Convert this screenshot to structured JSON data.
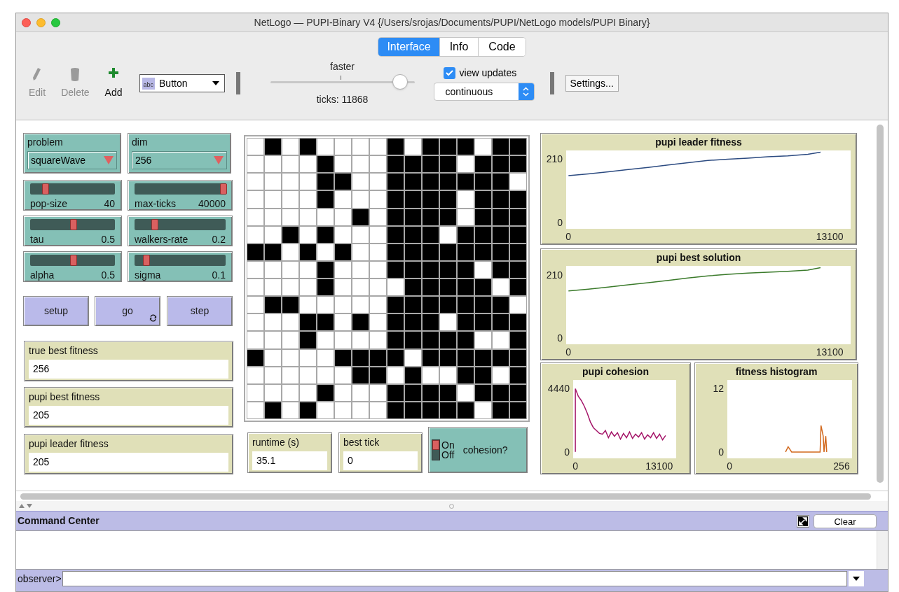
{
  "window": {
    "title": "NetLogo — PUPI-Binary V4 {/Users/srojas/Documents/PUPI/NetLogo models/PUPI Binary}"
  },
  "tabs": [
    {
      "label": "Interface",
      "selected": true
    },
    {
      "label": "Info",
      "selected": false
    },
    {
      "label": "Code",
      "selected": false
    }
  ],
  "toolbar": {
    "tools": [
      {
        "kind": "edit",
        "label": "Edit",
        "disabled": true
      },
      {
        "kind": "delete",
        "label": "Delete",
        "disabled": true
      },
      {
        "kind": "add",
        "label": "Add",
        "disabled": false
      }
    ],
    "widget_type": {
      "icon_text": "abc",
      "value": "Button"
    },
    "speed": {
      "label": "faster",
      "level": 0.95
    },
    "ticks": "ticks: 11868",
    "view_updates": {
      "label": "view updates",
      "checked": true
    },
    "update_mode": "continuous",
    "settings": "Settings..."
  },
  "choosers": [
    {
      "label": "problem",
      "value": "squareWave"
    },
    {
      "label": "dim",
      "value": "256"
    }
  ],
  "sliders": [
    {
      "label": "pop-size",
      "value": "40",
      "level": 0.15
    },
    {
      "label": "max-ticks",
      "value": "40000",
      "level": 1
    },
    {
      "label": "tau",
      "value": "0.5",
      "level": 0.5
    },
    {
      "label": "walkers-rate",
      "value": "0.2",
      "level": 0.2
    },
    {
      "label": "alpha",
      "value": "0.5",
      "level": 0.5
    },
    {
      "label": "sigma",
      "value": "0.1",
      "level": 0.1
    }
  ],
  "buttons": [
    {
      "label": "setup",
      "forever": false
    },
    {
      "label": "go",
      "forever": true
    },
    {
      "label": "step",
      "forever": false
    }
  ],
  "monitors": [
    {
      "label": "true best fitness",
      "value": "256"
    },
    {
      "label": "pupi best fitness",
      "value": "205"
    },
    {
      "label": "pupi leader fitness",
      "value": "205"
    },
    {
      "label": "runtime (s)",
      "value": "35.1"
    },
    {
      "label": "best tick",
      "value": "0"
    }
  ],
  "switch": {
    "on_label": "On",
    "off_label": "Off",
    "label": "cohesion?",
    "on": true
  },
  "world": {
    "cells": [
      [
        false,
        true,
        false,
        true,
        false,
        false,
        false,
        false,
        true,
        false,
        true,
        true,
        true,
        false,
        true,
        true
      ],
      [
        false,
        false,
        false,
        false,
        true,
        false,
        false,
        false,
        true,
        true,
        true,
        true,
        false,
        true,
        true,
        true
      ],
      [
        false,
        false,
        false,
        false,
        true,
        true,
        false,
        false,
        true,
        true,
        true,
        true,
        true,
        true,
        true,
        false
      ],
      [
        false,
        false,
        false,
        false,
        true,
        false,
        false,
        false,
        true,
        true,
        true,
        true,
        false,
        true,
        true,
        true
      ],
      [
        false,
        false,
        false,
        false,
        false,
        false,
        true,
        false,
        true,
        true,
        true,
        true,
        false,
        true,
        true,
        true
      ],
      [
        false,
        false,
        true,
        false,
        true,
        false,
        false,
        false,
        true,
        true,
        true,
        false,
        true,
        true,
        true,
        true
      ],
      [
        true,
        true,
        false,
        true,
        false,
        true,
        false,
        false,
        true,
        true,
        true,
        true,
        true,
        true,
        true,
        true
      ],
      [
        false,
        false,
        false,
        false,
        true,
        false,
        false,
        false,
        true,
        true,
        true,
        true,
        true,
        false,
        true,
        true
      ],
      [
        false,
        false,
        false,
        false,
        true,
        false,
        false,
        false,
        false,
        true,
        true,
        true,
        true,
        true,
        false,
        true
      ],
      [
        false,
        true,
        true,
        false,
        false,
        false,
        false,
        false,
        true,
        true,
        true,
        true,
        true,
        true,
        true,
        false
      ],
      [
        false,
        false,
        false,
        true,
        true,
        false,
        true,
        false,
        true,
        true,
        true,
        false,
        true,
        true,
        true,
        true
      ],
      [
        false,
        false,
        false,
        true,
        false,
        false,
        false,
        false,
        true,
        true,
        true,
        true,
        true,
        false,
        false,
        true
      ],
      [
        true,
        false,
        false,
        false,
        false,
        true,
        true,
        true,
        true,
        false,
        true,
        true,
        true,
        true,
        true,
        true
      ],
      [
        false,
        false,
        false,
        false,
        false,
        false,
        true,
        true,
        false,
        true,
        false,
        false,
        true,
        true,
        false,
        true
      ],
      [
        false,
        false,
        false,
        false,
        true,
        false,
        false,
        false,
        true,
        true,
        true,
        true,
        false,
        true,
        true,
        true
      ],
      [
        false,
        true,
        false,
        true,
        false,
        false,
        false,
        false,
        true,
        true,
        true,
        true,
        true,
        false,
        true,
        true
      ]
    ]
  },
  "plots": [
    {
      "title": "pupi leader fitness",
      "chart_data": {
        "type": "line",
        "xlim": [
          -115,
          14150
        ],
        "ylim": [
          -20,
          238
        ],
        "xticks": [
          0,
          13100
        ],
        "yticks": [
          0,
          210
        ],
        "x": [
          0,
          1000,
          2000,
          3000,
          4000,
          5000,
          6000,
          7000,
          8000,
          9000,
          10000,
          11000,
          12000,
          12640
        ],
        "series": [
          {
            "color": "#2b4a80",
            "values": [
              155,
              161,
              168,
              175,
              182,
              190,
              198,
              205,
              209,
              213,
              217,
              220,
              225,
              232
            ]
          }
        ]
      }
    },
    {
      "title": "pupi best solution",
      "chart_data": {
        "type": "line",
        "xlim": [
          -115,
          14150
        ],
        "ylim": [
          -20,
          240
        ],
        "xticks": [
          0,
          13100
        ],
        "yticks": [
          0,
          210
        ],
        "x": [
          0,
          1000,
          2000,
          3000,
          4000,
          5000,
          6000,
          7000,
          8000,
          9000,
          10000,
          11000,
          12000,
          12640
        ],
        "series": [
          {
            "color": "#3a7a2a",
            "values": [
              157,
              163,
              170,
              177,
              184,
              192,
              200,
              207,
              212,
              216,
              219,
              222,
              226,
              234
            ]
          }
        ]
      }
    },
    {
      "title": "pupi cohesion",
      "chart_data": {
        "type": "line",
        "xlim": [
          -340,
          15750
        ],
        "ylim": [
          -450,
          5050
        ],
        "xticks": [
          0,
          13100
        ],
        "yticks": [
          0,
          4440
        ],
        "x": [
          0,
          0,
          470,
          940,
          1410,
          1880,
          2350,
          2820,
          3290,
          3760,
          4230,
          4700,
          5170,
          5640,
          6110,
          6580,
          7050,
          7520,
          7990,
          8460,
          8930,
          9400,
          9870,
          10340,
          10810,
          11280,
          11750,
          12220,
          12690,
          13160,
          13630,
          14100
        ],
        "series": [
          {
            "color": "#a5176a",
            "values": [
              0,
              4440,
              3900,
              3600,
              3200,
              2700,
              2100,
              1700,
              1500,
              1300,
              1250,
              1500,
              1000,
              1400,
              1100,
              1350,
              900,
              1300,
              1000,
              1400,
              950,
              1250,
              1050,
              1350,
              900,
              1200,
              1000,
              1350,
              950,
              1250,
              850,
              1150
            ]
          }
        ]
      }
    },
    {
      "title": "fitness histogram",
      "chart_data": {
        "type": "line",
        "xlim": [
          -5,
          280
        ],
        "ylim": [
          -1.2,
          13.6
        ],
        "xticks": [
          0,
          256
        ],
        "yticks": [
          0,
          12
        ],
        "x": [
          128,
          134,
          142,
          207,
          209,
          214,
          216,
          220,
          222
        ],
        "series": [
          {
            "color": "#d2691e",
            "values": [
              0,
              1,
              0,
              0,
              5,
              3,
              0,
              3,
              0
            ]
          }
        ]
      }
    }
  ],
  "command_center": {
    "title": "Command Center",
    "clear": "Clear",
    "prompt": "observer>"
  }
}
